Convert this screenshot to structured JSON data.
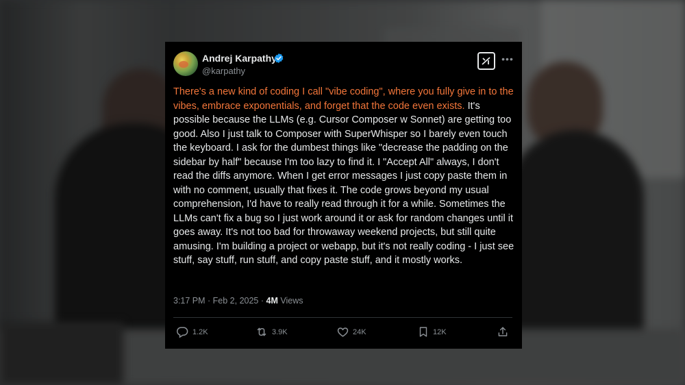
{
  "tweet": {
    "author_name": "Andrej Karpathy",
    "author_handle": "@karpathy",
    "text_highlight": "There's a new kind of coding I call \"vibe coding\", where you fully give in to the vibes, embrace exponentials, and forget that the code even exists.",
    "text_body": " It's possible because the LLMs (e.g. Cursor Composer w Sonnet) are getting too good. Also I just talk to Composer with SuperWhisper so I barely even touch the keyboard. I ask for the dumbest things like \"decrease the padding on the sidebar by half\" because I'm too lazy to find it. I \"Accept All\" always, I don't read the diffs anymore. When I get error messages I just copy paste them in with no comment, usually that fixes it. The code grows beyond my usual comprehension, I'd have to really read through it for a while. Sometimes the LLMs can't fix a bug so I just work around it or ask for random changes until it goes away. It's not too bad for throwaway weekend projects, but still quite amusing. I'm building a project or webapp, but it's not really coding - I just see stuff, say stuff, run stuff, and copy paste stuff, and it mostly works.",
    "timestamp": "3:17 PM · Feb 2, 2025 · ",
    "views_count": "4M",
    "views_label": " Views"
  },
  "actions": {
    "replies": "1.2K",
    "reposts": "3.9K",
    "likes": "24K",
    "bookmarks": "12K"
  },
  "icons": {
    "verified": "verified-badge-icon",
    "grok": "grok-icon",
    "more": "more-icon",
    "reply": "reply-icon",
    "repost": "repost-icon",
    "like": "heart-icon",
    "bookmark": "bookmark-icon",
    "share": "share-icon"
  },
  "colors": {
    "highlight": "#f3763a",
    "text": "#e7e9ea",
    "muted": "#8b9095",
    "verified": "#1d9bf0",
    "card": "#000000"
  }
}
